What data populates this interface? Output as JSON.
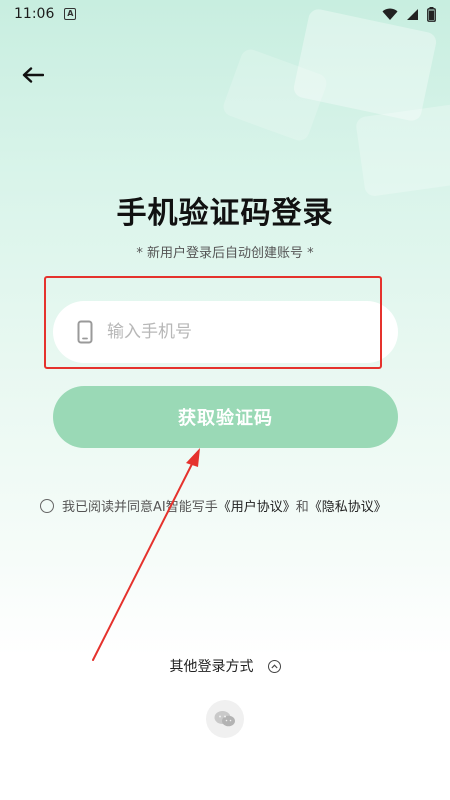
{
  "status_bar": {
    "time": "11:06",
    "notification_icon_label": "A",
    "icons": [
      "wifi-icon",
      "signal-icon",
      "battery-icon"
    ]
  },
  "header": {
    "back_icon": "back-arrow-icon"
  },
  "main": {
    "title": "手机验证码登录",
    "subtitle": "* 新用户登录后自动创建账号 *",
    "phone_input": {
      "icon": "phone-icon",
      "placeholder": "输入手机号",
      "value": ""
    },
    "get_code_button": "获取验证码",
    "agreement": {
      "prefix": "我已阅读并同意AI智能写手",
      "user_agreement": "《用户协议》",
      "and": "和",
      "privacy_policy": "《隐私协议》",
      "checked": false
    }
  },
  "footer": {
    "other_login_label": "其他登录方式",
    "toggle_icon": "chevron-up-icon",
    "wechat_icon": "wechat-icon"
  },
  "colors": {
    "accent_button": "#9ad9b6",
    "highlight_annotation": "#e5322d",
    "gradient_top": "#c8eee0"
  }
}
